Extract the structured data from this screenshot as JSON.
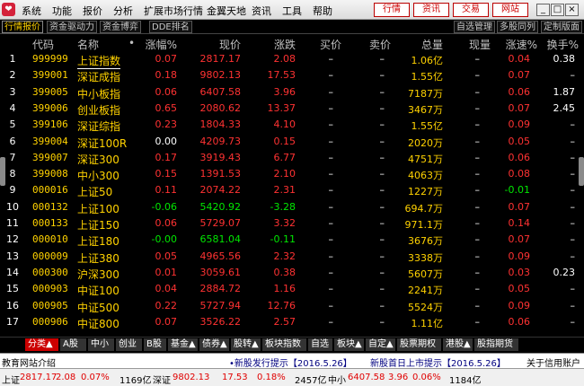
{
  "menubar": {
    "items": [
      "系统",
      "功能",
      "报价",
      "分析",
      "扩展市场行情",
      "金翼天地",
      "资讯",
      "工具",
      "帮助"
    ],
    "right_buttons": [
      "行情",
      "资讯",
      "交易",
      "网站"
    ]
  },
  "tabs": {
    "left": [
      "行情报价",
      "资金驱动力",
      "资金博弈",
      "DDE排名"
    ],
    "right": [
      "自选管理",
      "多股同列",
      "定制版面"
    ]
  },
  "columns": [
    "代码",
    "名称",
    "•",
    "涨幅%",
    "现价",
    "涨跌",
    "买价",
    "卖价",
    "总量",
    "现量",
    "涨速%",
    "换手%"
  ],
  "rows": [
    {
      "n": "1",
      "code": "999999",
      "name": "上证指数",
      "pct": "0.07",
      "price": "2817.17",
      "chg": "2.08",
      "bid": "–",
      "ask": "–",
      "vol": "1.06亿",
      "cur": "–",
      "spd": "0.04",
      "turn": "0.38",
      "dir": "up",
      "spd_dir": "up"
    },
    {
      "n": "2",
      "code": "399001",
      "name": "深证成指",
      "pct": "0.18",
      "price": "9802.13",
      "chg": "17.53",
      "bid": "–",
      "ask": "–",
      "vol": "1.55亿",
      "cur": "–",
      "spd": "0.07",
      "turn": "–",
      "dir": "up",
      "spd_dir": "up"
    },
    {
      "n": "3",
      "code": "399005",
      "name": "中小板指",
      "pct": "0.06",
      "price": "6407.58",
      "chg": "3.96",
      "bid": "–",
      "ask": "–",
      "vol": "7187万",
      "cur": "–",
      "spd": "0.06",
      "turn": "1.87",
      "dir": "up",
      "spd_dir": "up"
    },
    {
      "n": "4",
      "code": "399006",
      "name": "创业板指",
      "pct": "0.65",
      "price": "2080.62",
      "chg": "13.37",
      "bid": "–",
      "ask": "–",
      "vol": "3467万",
      "cur": "–",
      "spd": "0.07",
      "turn": "2.45",
      "dir": "up",
      "spd_dir": "up"
    },
    {
      "n": "5",
      "code": "399106",
      "name": "深证综指",
      "pct": "0.23",
      "price": "1804.33",
      "chg": "4.10",
      "bid": "–",
      "ask": "–",
      "vol": "1.55亿",
      "cur": "–",
      "spd": "0.09",
      "turn": "–",
      "dir": "up",
      "spd_dir": "up"
    },
    {
      "n": "6",
      "code": "399004",
      "name": "深证100R",
      "pct": "0.00",
      "price": "4209.73",
      "chg": "0.15",
      "bid": "–",
      "ask": "–",
      "vol": "2020万",
      "cur": "–",
      "spd": "0.05",
      "turn": "–",
      "dir": "up",
      "spd_dir": "up"
    },
    {
      "n": "7",
      "code": "399007",
      "name": "深证300",
      "pct": "0.17",
      "price": "3919.43",
      "chg": "6.77",
      "bid": "–",
      "ask": "–",
      "vol": "4751万",
      "cur": "–",
      "spd": "0.06",
      "turn": "–",
      "dir": "up",
      "spd_dir": "up"
    },
    {
      "n": "8",
      "code": "399008",
      "name": "中小300",
      "pct": "0.15",
      "price": "1391.53",
      "chg": "2.10",
      "bid": "–",
      "ask": "–",
      "vol": "4063万",
      "cur": "–",
      "spd": "0.08",
      "turn": "–",
      "dir": "up",
      "spd_dir": "up"
    },
    {
      "n": "9",
      "code": "000016",
      "name": "上证50",
      "pct": "0.11",
      "price": "2074.22",
      "chg": "2.31",
      "bid": "–",
      "ask": "–",
      "vol": "1227万",
      "cur": "–",
      "spd": "-0.01",
      "turn": "–",
      "dir": "up",
      "spd_dir": "down"
    },
    {
      "n": "10",
      "code": "000132",
      "name": "上证100",
      "pct": "-0.06",
      "price": "5420.92",
      "chg": "-3.28",
      "bid": "–",
      "ask": "–",
      "vol": "694.7万",
      "cur": "–",
      "spd": "0.07",
      "turn": "–",
      "dir": "down",
      "spd_dir": "up"
    },
    {
      "n": "11",
      "code": "000133",
      "name": "上证150",
      "pct": "0.06",
      "price": "5729.07",
      "chg": "3.32",
      "bid": "–",
      "ask": "–",
      "vol": "971.1万",
      "cur": "–",
      "spd": "0.14",
      "turn": "–",
      "dir": "up",
      "spd_dir": "up"
    },
    {
      "n": "12",
      "code": "000010",
      "name": "上证180",
      "pct": "-0.00",
      "price": "6581.04",
      "chg": "-0.11",
      "bid": "–",
      "ask": "–",
      "vol": "3676万",
      "cur": "–",
      "spd": "0.07",
      "turn": "–",
      "dir": "down",
      "spd_dir": "up"
    },
    {
      "n": "13",
      "code": "000009",
      "name": "上证380",
      "pct": "0.05",
      "price": "4965.56",
      "chg": "2.32",
      "bid": "–",
      "ask": "–",
      "vol": "3338万",
      "cur": "–",
      "spd": "0.09",
      "turn": "–",
      "dir": "up",
      "spd_dir": "up"
    },
    {
      "n": "14",
      "code": "000300",
      "name": "沪深300",
      "pct": "0.01",
      "price": "3059.61",
      "chg": "0.38",
      "bid": "–",
      "ask": "–",
      "vol": "5607万",
      "cur": "–",
      "spd": "0.03",
      "turn": "0.23",
      "dir": "up",
      "spd_dir": "up"
    },
    {
      "n": "15",
      "code": "000903",
      "name": "中证100",
      "pct": "0.04",
      "price": "2884.72",
      "chg": "1.16",
      "bid": "–",
      "ask": "–",
      "vol": "2241万",
      "cur": "–",
      "spd": "0.05",
      "turn": "–",
      "dir": "up",
      "spd_dir": "up"
    },
    {
      "n": "16",
      "code": "000905",
      "name": "中证500",
      "pct": "0.22",
      "price": "5727.94",
      "chg": "12.76",
      "bid": "–",
      "ask": "–",
      "vol": "5524万",
      "cur": "–",
      "spd": "0.09",
      "turn": "–",
      "dir": "up",
      "spd_dir": "up"
    },
    {
      "n": "17",
      "code": "000906",
      "name": "中证800",
      "pct": "0.07",
      "price": "3526.22",
      "chg": "2.57",
      "bid": "–",
      "ask": "–",
      "vol": "1.11亿",
      "cur": "–",
      "spd": "0.06",
      "turn": "–",
      "dir": "up",
      "spd_dir": "up"
    }
  ],
  "category_tabs": [
    "分类▲",
    "A股",
    "中小",
    "创业",
    "B股",
    "基金▲",
    "债券▲",
    "股转▲",
    "板块指数",
    "自选",
    "板块▲",
    "自定▲",
    "股票期权",
    "港股▲",
    "股指期货"
  ],
  "ticker": {
    "left_text": "教育网站介绍",
    "mid_text": "•新股发行提示【2016.5.26】",
    "right_text": "新股首日上市提示【2016.5.26】",
    "far_right": "关于信用账户"
  },
  "status": {
    "sh_label": "上证",
    "sh_price": "2817.17",
    "sh_chg": "2.08",
    "sh_pct": "0.07%",
    "sh_amount": "1169亿",
    "sz_label": "深证",
    "sz_price": "9802.13",
    "sz_chg": "17.53",
    "sz_pct": "0.18%",
    "sz_amount": "2457亿",
    "zx_label": "中小",
    "zx_price": "6407.58",
    "zx_chg": "3.96",
    "zx_pct": "0.06%",
    "zx_amount": "1184亿"
  },
  "colors": {
    "up": "#ff3232",
    "down": "#00e600",
    "name": "#ffd200",
    "bg": "#000000"
  }
}
